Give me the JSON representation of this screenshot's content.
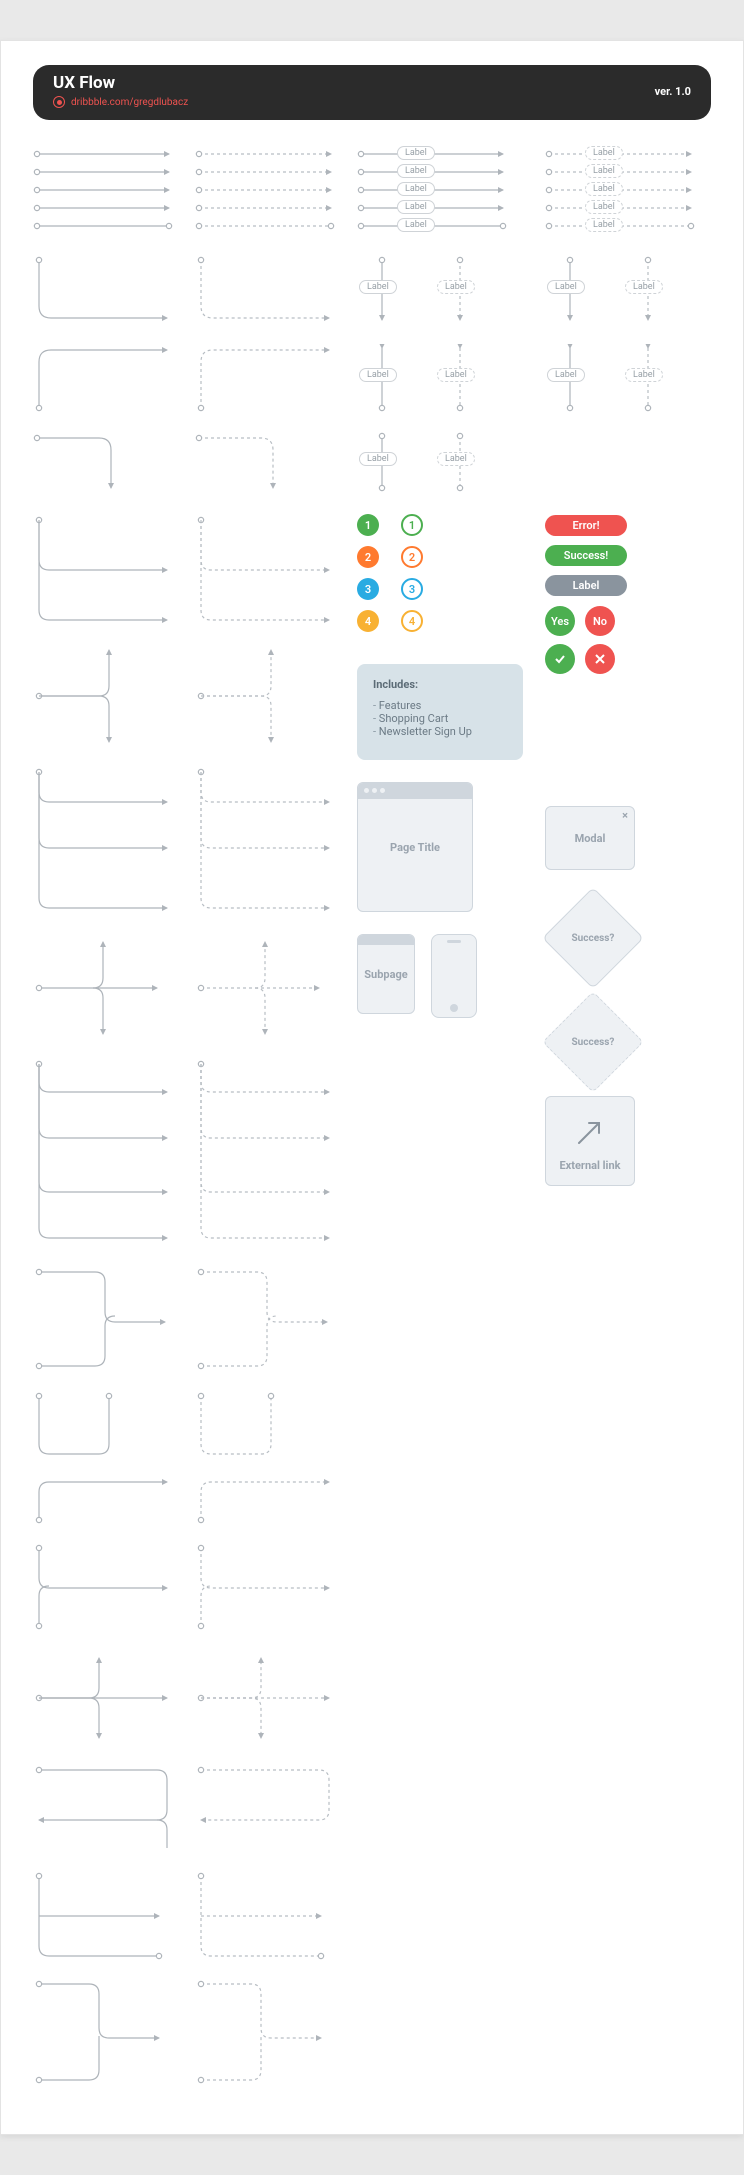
{
  "header": {
    "title": "UX Flow",
    "attribution": "dribbble.com/gregdlubacz",
    "version": "ver. 1.0"
  },
  "label": "Label",
  "pills": {
    "error": "Error!",
    "success": "Success!",
    "generic": "Label",
    "yes": "Yes",
    "no": "No"
  },
  "note": {
    "heading": "Includes:",
    "items": [
      "Features",
      "Shopping Cart",
      "Newsletter Sign Up"
    ]
  },
  "boxes": {
    "page": "Page Title",
    "sub": "Subpage",
    "modal": "Modal",
    "decision": "Success?",
    "external": "External link"
  },
  "numbers": [
    "1",
    "2",
    "3",
    "4"
  ]
}
